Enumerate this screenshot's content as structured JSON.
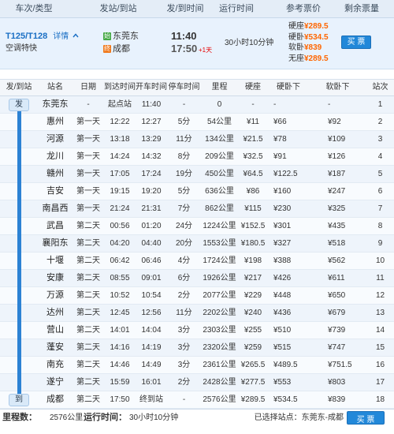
{
  "colors": {
    "link_blue": "#1a6fc4",
    "price_orange": "#ff6600",
    "day_offset_red": "#e60000",
    "button_blue": "#2288d9",
    "route_line_blue": "#2c82d4",
    "start_icon_green": "#45a845",
    "end_icon_orange": "#f07a1e"
  },
  "header": {
    "train_col": "车次/类型",
    "station_col": "发站/到站",
    "time_col": "发/到时间",
    "duration_col": "运行时间",
    "price_col": "参考票价",
    "remaining_col": "剩余票量"
  },
  "train": {
    "number": "T125/T128",
    "detail_label": "详情",
    "detail_icon": "chevron-up-icon",
    "type": "空调特快",
    "from_badge": "始",
    "from_station": "东莞东",
    "to_badge": "终",
    "to_station": "成都",
    "depart_time": "11:40",
    "arrive_time": "17:50",
    "arrive_day_offset": "+1天",
    "duration": "30小时10分钟",
    "prices": [
      {
        "seat": "硬座",
        "price": "¥289.5"
      },
      {
        "seat": "硬卧",
        "price": "¥534.5"
      },
      {
        "seat": "软卧",
        "price": "¥839"
      },
      {
        "seat": "无座",
        "price": "¥289.5"
      }
    ],
    "buy_label": "买 票"
  },
  "stops_table": {
    "columns": [
      "发/到站",
      "站名",
      "日期",
      "到达时间",
      "开车时间",
      "停车时间",
      "里程",
      "硬座",
      "硬卧下",
      "软卧下",
      "站次"
    ],
    "depart_marker": "发",
    "arrive_marker": "到",
    "rows": [
      {
        "station": "东莞东",
        "date": "-",
        "arrive": "起点站",
        "depart": "11:40",
        "stop": "-",
        "distance": "0",
        "hard_seat": "-",
        "hard_sleeper_lower": "-",
        "soft_sleeper_lower": "-",
        "seq": "1"
      },
      {
        "station": "惠州",
        "date": "第一天",
        "arrive": "12:22",
        "depart": "12:27",
        "stop": "5分",
        "distance": "54公里",
        "hard_seat": "¥11",
        "hard_sleeper_lower": "¥66",
        "soft_sleeper_lower": "¥92",
        "seq": "2"
      },
      {
        "station": "河源",
        "date": "第一天",
        "arrive": "13:18",
        "depart": "13:29",
        "stop": "11分",
        "distance": "134公里",
        "hard_seat": "¥21.5",
        "hard_sleeper_lower": "¥78",
        "soft_sleeper_lower": "¥109",
        "seq": "3"
      },
      {
        "station": "龙川",
        "date": "第一天",
        "arrive": "14:24",
        "depart": "14:32",
        "stop": "8分",
        "distance": "209公里",
        "hard_seat": "¥32.5",
        "hard_sleeper_lower": "¥91",
        "soft_sleeper_lower": "¥126",
        "seq": "4"
      },
      {
        "station": "赣州",
        "date": "第一天",
        "arrive": "17:05",
        "depart": "17:24",
        "stop": "19分",
        "distance": "450公里",
        "hard_seat": "¥64.5",
        "hard_sleeper_lower": "¥122.5",
        "soft_sleeper_lower": "¥187",
        "seq": "5"
      },
      {
        "station": "吉安",
        "date": "第一天",
        "arrive": "19:15",
        "depart": "19:20",
        "stop": "5分",
        "distance": "636公里",
        "hard_seat": "¥86",
        "hard_sleeper_lower": "¥160",
        "soft_sleeper_lower": "¥247",
        "seq": "6"
      },
      {
        "station": "南昌西",
        "date": "第一天",
        "arrive": "21:24",
        "depart": "21:31",
        "stop": "7分",
        "distance": "862公里",
        "hard_seat": "¥115",
        "hard_sleeper_lower": "¥230",
        "soft_sleeper_lower": "¥325",
        "seq": "7"
      },
      {
        "station": "武昌",
        "date": "第二天",
        "arrive": "00:56",
        "depart": "01:20",
        "stop": "24分",
        "distance": "1224公里",
        "hard_seat": "¥152.5",
        "hard_sleeper_lower": "¥301",
        "soft_sleeper_lower": "¥435",
        "seq": "8"
      },
      {
        "station": "襄阳东",
        "date": "第二天",
        "arrive": "04:20",
        "depart": "04:40",
        "stop": "20分",
        "distance": "1553公里",
        "hard_seat": "¥180.5",
        "hard_sleeper_lower": "¥327",
        "soft_sleeper_lower": "¥518",
        "seq": "9"
      },
      {
        "station": "十堰",
        "date": "第二天",
        "arrive": "06:42",
        "depart": "06:46",
        "stop": "4分",
        "distance": "1724公里",
        "hard_seat": "¥198",
        "hard_sleeper_lower": "¥388",
        "soft_sleeper_lower": "¥562",
        "seq": "10"
      },
      {
        "station": "安康",
        "date": "第二天",
        "arrive": "08:55",
        "depart": "09:01",
        "stop": "6分",
        "distance": "1926公里",
        "hard_seat": "¥217",
        "hard_sleeper_lower": "¥426",
        "soft_sleeper_lower": "¥611",
        "seq": "11"
      },
      {
        "station": "万源",
        "date": "第二天",
        "arrive": "10:52",
        "depart": "10:54",
        "stop": "2分",
        "distance": "2077公里",
        "hard_seat": "¥229",
        "hard_sleeper_lower": "¥448",
        "soft_sleeper_lower": "¥650",
        "seq": "12"
      },
      {
        "station": "达州",
        "date": "第二天",
        "arrive": "12:45",
        "depart": "12:56",
        "stop": "11分",
        "distance": "2202公里",
        "hard_seat": "¥240",
        "hard_sleeper_lower": "¥436",
        "soft_sleeper_lower": "¥679",
        "seq": "13"
      },
      {
        "station": "营山",
        "date": "第二天",
        "arrive": "14:01",
        "depart": "14:04",
        "stop": "3分",
        "distance": "2303公里",
        "hard_seat": "¥255",
        "hard_sleeper_lower": "¥510",
        "soft_sleeper_lower": "¥739",
        "seq": "14"
      },
      {
        "station": "蓬安",
        "date": "第二天",
        "arrive": "14:16",
        "depart": "14:19",
        "stop": "3分",
        "distance": "2320公里",
        "hard_seat": "¥259",
        "hard_sleeper_lower": "¥515",
        "soft_sleeper_lower": "¥747",
        "seq": "15"
      },
      {
        "station": "南充",
        "date": "第二天",
        "arrive": "14:46",
        "depart": "14:49",
        "stop": "3分",
        "distance": "2361公里",
        "hard_seat": "¥265.5",
        "hard_sleeper_lower": "¥489.5",
        "soft_sleeper_lower": "¥751.5",
        "seq": "16"
      },
      {
        "station": "遂宁",
        "date": "第二天",
        "arrive": "15:59",
        "depart": "16:01",
        "stop": "2分",
        "distance": "2428公里",
        "hard_seat": "¥277.5",
        "hard_sleeper_lower": "¥553",
        "soft_sleeper_lower": "¥803",
        "seq": "17"
      },
      {
        "station": "成都",
        "date": "第二天",
        "arrive": "17:50",
        "depart": "终到站",
        "stop": "-",
        "distance": "2576公里",
        "hard_seat": "¥289.5",
        "hard_sleeper_lower": "¥534.5",
        "soft_sleeper_lower": "¥839",
        "seq": "18"
      }
    ]
  },
  "footer": {
    "distance_label": "里程数：",
    "distance_value": "2576公里",
    "duration_label": "运行时间：",
    "duration_value": "30小时10分钟",
    "selected_label": "已选择站点：",
    "selected_value": "东莞东-成都",
    "buy_label": "买 票"
  }
}
